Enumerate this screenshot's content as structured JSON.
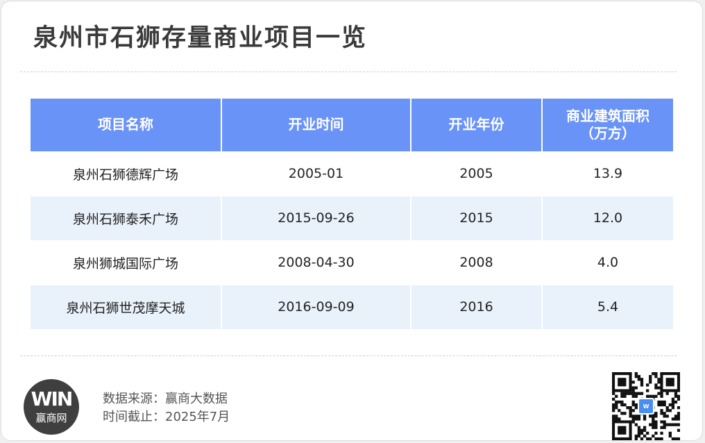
{
  "title": "泉州市石狮存量商业项目一览",
  "table": {
    "headers": [
      "项目名称",
      "开业时间",
      "开业年份",
      "商业建筑面积\n（万方）"
    ],
    "rows": [
      [
        "泉州石狮德辉广场",
        "2005-01",
        "2005",
        "13.9"
      ],
      [
        "泉州石狮泰禾广场",
        "2015-09-26",
        "2015",
        "12.0"
      ],
      [
        "泉州狮城国际广场",
        "2008-04-30",
        "2008",
        "4.0"
      ],
      [
        "泉州石狮世茂摩天城",
        "2016-09-09",
        "2016",
        "5.4"
      ]
    ]
  },
  "footer": {
    "logo_mark": "WIN",
    "logo_text": "赢商网",
    "source_line": "数据来源：赢商大数据",
    "date_line": "时间截止：2025年7月"
  },
  "colors": {
    "header_bg": "#6a93f8",
    "alt_row_bg": "#e9f1fa",
    "qr_center": "#4a8ef0"
  },
  "icons": {
    "logo": "winshang-logo-icon",
    "qr": "qr-code-icon"
  }
}
